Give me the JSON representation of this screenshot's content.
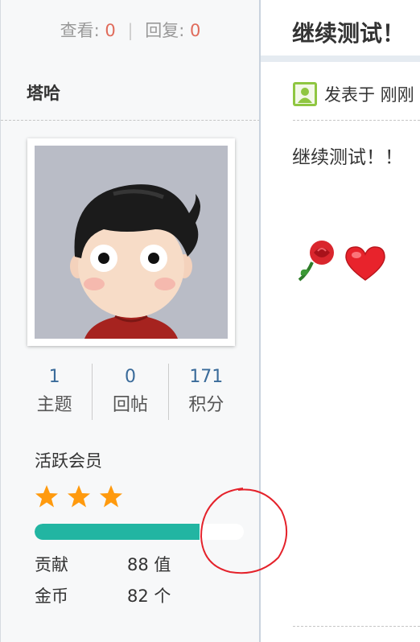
{
  "profile": {
    "views_label": "查看:",
    "views_value": "0",
    "replies_label": "回复:",
    "replies_value": "0",
    "separator": "|",
    "username": "塔哈",
    "stats": [
      {
        "value": "1",
        "label": "主题"
      },
      {
        "value": "0",
        "label": "回帖"
      },
      {
        "value": "171",
        "label": "积分"
      }
    ],
    "level": "活跃会员",
    "stars_count": 3,
    "progress_fraction": 0.79,
    "contribution_label": "贡献",
    "contribution_value": "88 值",
    "gold_label": "金币",
    "gold_value": "82 个"
  },
  "post": {
    "title": "继续测试！",
    "meta": "发表于 刚刚",
    "body": "继续测试！！",
    "emojis": [
      "rose-icon",
      "heart-icon"
    ]
  },
  "colors": {
    "accent_number": "#e06b5b",
    "link_blue": "#3a6b9a",
    "progress": "#22b5a2",
    "star": "#ff9a0e"
  }
}
